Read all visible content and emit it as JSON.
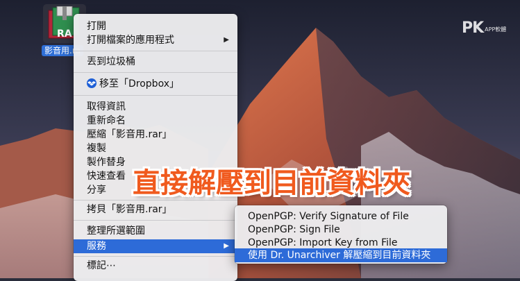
{
  "desktop": {
    "file": {
      "label": "影音用.rar",
      "label_visible": "影音用.ra",
      "icon_text": "RA"
    },
    "watermark": {
      "text": "PK",
      "tag": "APP軟體"
    }
  },
  "context_menu": {
    "items": [
      {
        "label": "打開",
        "group": 1
      },
      {
        "label": "打開檔案的應用程式",
        "has_submenu": true,
        "group": 1
      },
      {
        "label": "丟到垃圾桶",
        "group": 2
      },
      {
        "label": "移至「Dropbox」",
        "icon": "dropbox-icon",
        "group": 3
      },
      {
        "label": "取得資訊",
        "group": 4
      },
      {
        "label": "重新命名",
        "group": 4
      },
      {
        "label": "壓縮「影音用.rar」",
        "group": 4
      },
      {
        "label": "複製",
        "group": 4
      },
      {
        "label": "製作替身",
        "group": 4
      },
      {
        "label": "快速查看",
        "group": 4
      },
      {
        "label": "分享",
        "group": 4
      },
      {
        "label": "拷貝「影音用.rar」",
        "group": 5
      },
      {
        "label": "整理所選範圍",
        "group": 6
      },
      {
        "label": "服務",
        "has_submenu": true,
        "active": true,
        "group": 6
      },
      {
        "label": "標記⋯",
        "group": 7
      }
    ],
    "submenu_arrow": "▶"
  },
  "services_submenu": {
    "items": [
      {
        "label": "OpenPGP: Verify Signature of File"
      },
      {
        "label": "OpenPGP: Sign File"
      },
      {
        "label": "OpenPGP: Import Key from File"
      },
      {
        "label": "使用 Dr. Unarchiver 解壓縮到目前資料夾",
        "active": true
      }
    ]
  },
  "banner": {
    "text": "直接解壓到目前資料夾",
    "color": "#f05a1e"
  },
  "colors": {
    "highlight": "#2d6bd8",
    "menu_bg": "#ececee"
  }
}
